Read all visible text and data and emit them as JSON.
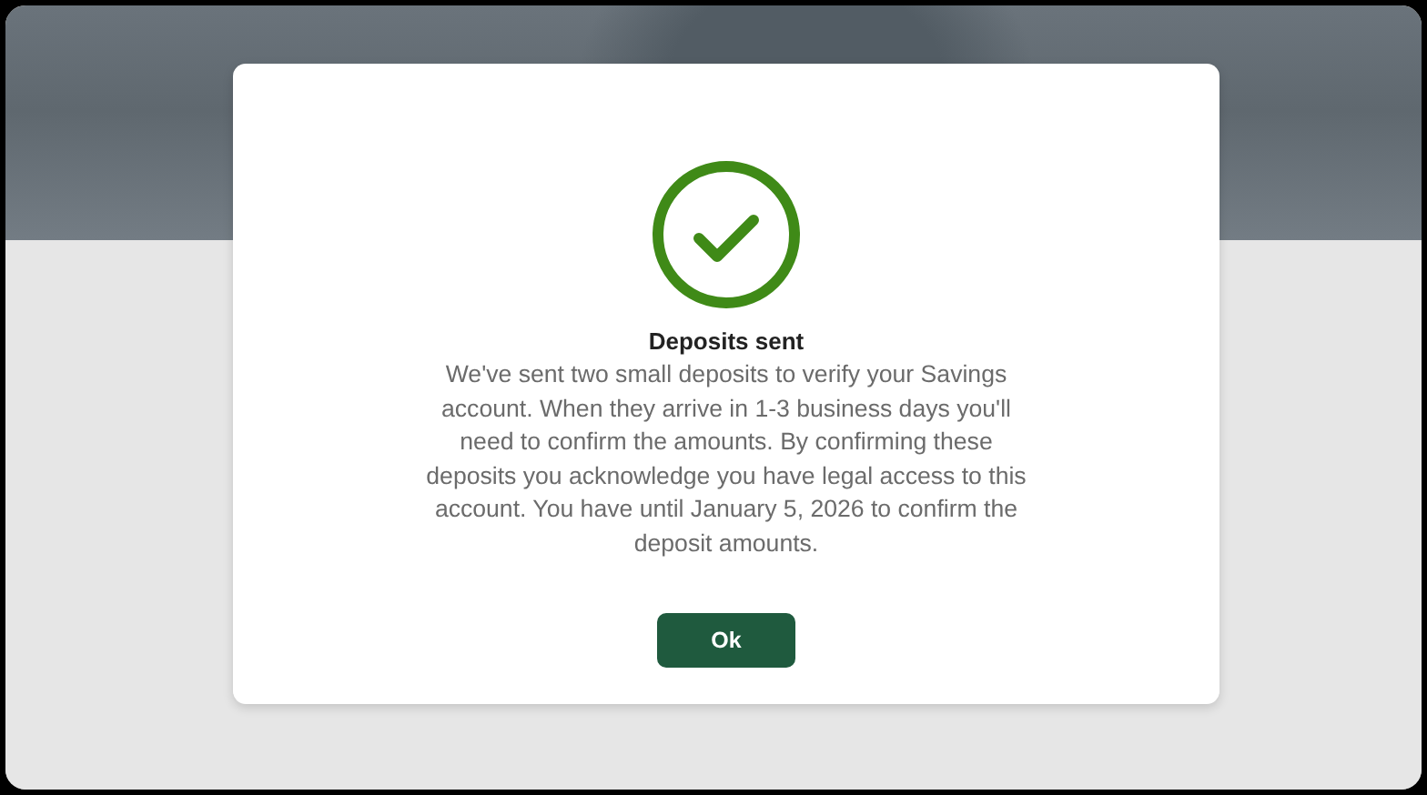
{
  "dialog": {
    "title": "Deposits sent",
    "message": "We've sent two small deposits to verify your Savings account. When they arrive in 1-3 business days you'll need to confirm the amounts. By confirming these deposits you acknowledge you have legal access to this account. You have until January 5, 2026 to confirm the deposit amounts.",
    "button": "Ok"
  }
}
